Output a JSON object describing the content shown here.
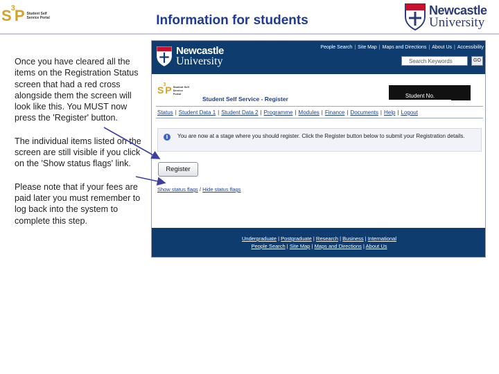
{
  "slide": {
    "title": "Information for students",
    "s3p_logo": {
      "mark": "S",
      "sup": "3",
      "mark_end": "P",
      "sub": "Student Self Service Portal"
    },
    "nu_logo": {
      "line1": "Newcastle",
      "line2": "University"
    },
    "paragraphs": [
      "Once you have cleared all the items on the Registration Status screen that had a red cross alongside them the screen will look like this. You MUST now press the 'Register' button.",
      "The individual items listed on the screen are still visible if you click on the 'Show status flags' link.",
      "Please note that if your fees are paid later you must remember to log back into the system to complete this step."
    ]
  },
  "screenshot": {
    "logo": {
      "line1": "Newcastle",
      "line2": "University"
    },
    "util_links": [
      "People Search",
      "Site Map",
      "Maps and Directions",
      "About Us",
      "Accessibility"
    ],
    "search_placeholder": "Search Keywords",
    "go_label": "GO",
    "s3p_logo": {
      "mark": "S",
      "sup": "3",
      "mark_end": "P",
      "sub": "Student Self Service Portal"
    },
    "page_heading": "Student Self Service - Register",
    "student_no_label": "Student No.",
    "nav": [
      "Status",
      "Student Data 1",
      "Student Data 2",
      "Programme",
      "Modules",
      "Finance",
      "Documents",
      "Help",
      "Logout"
    ],
    "info_message": "You are now at a stage where you should register. Click the Register button below to submit your Registration details.",
    "info_icon": "i",
    "register_label": "Register",
    "show_flags": "Show status flags",
    "flags_sep": "/",
    "hide_flags": "Hide status flags",
    "footer_row1": [
      "Undergraduate",
      "Postgraduate",
      "Research",
      "Business",
      "International"
    ],
    "footer_row2": [
      "People Search",
      "Site Map",
      "Maps and Directions",
      "About Us"
    ]
  },
  "colors": {
    "title": "#1f3a93",
    "banner": "#0f3c6e",
    "arrow": "#3b3fa0",
    "logo_gold": "#d4a22a"
  },
  "icons": [
    "shield-icon",
    "info-icon"
  ]
}
